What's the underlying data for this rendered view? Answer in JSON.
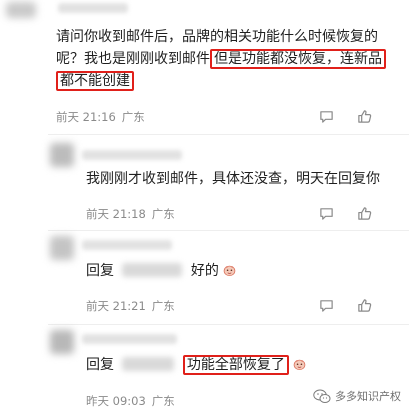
{
  "comments": [
    {
      "text_plain": "请问你收到邮件后，品牌的相关功能什么时候恢复的呢？我也是刚刚收到邮件",
      "text_line1": "请问你收到邮件后，品牌的相关功能什么时候恢复的",
      "text_line2_prefix": "呢？我也是刚刚收到邮件",
      "highlight_part1": "但是功能都没恢复，连新品",
      "highlight_part2": "都不能创建",
      "time": "前天 21:16",
      "location": "广东"
    },
    {
      "text": "我刚刚才收到邮件，具体还没查，明天在回复你",
      "time": "前天 21:18",
      "location": "广东"
    },
    {
      "reply_prefix": "回复",
      "text": "好的",
      "time": "前天 21:21",
      "location": "广东"
    },
    {
      "reply_prefix": "回复",
      "highlight": "功能全部恢复了",
      "time": "昨天 09:03",
      "location": "广东"
    }
  ],
  "watermark": {
    "text": "多多知识产权"
  },
  "icons": [
    "comment-icon",
    "star-icon",
    "like-icon",
    "emoji-icon",
    "wechat-logo-icon"
  ],
  "colors": {
    "highlight_border": "#e0201a",
    "meta_text": "#8a8a8a"
  }
}
